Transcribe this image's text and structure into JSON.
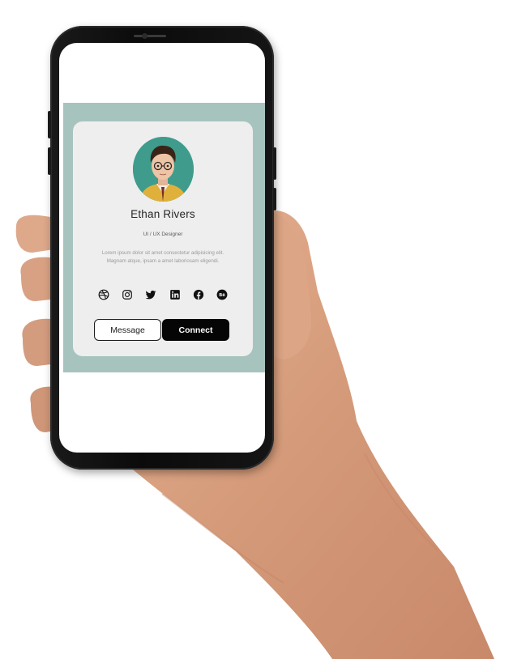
{
  "profile": {
    "name": "Ethan Rivers",
    "role": "UI / UX Designer",
    "bio": "Lorem ipsum dolor sit amet consectetur adipisicing elit. Magnam atque, ipsam a amet laboriosam eligendi."
  },
  "socials": [
    {
      "icon": "dribbble-icon"
    },
    {
      "icon": "instagram-icon"
    },
    {
      "icon": "twitter-icon"
    },
    {
      "icon": "linkedin-icon"
    },
    {
      "icon": "facebook-icon"
    },
    {
      "icon": "behance-icon",
      "label": "Bē"
    }
  ],
  "actions": {
    "message_label": "Message",
    "connect_label": "Connect"
  },
  "colors": {
    "app_background": "#a6c4bd",
    "card_background": "#eeeeee",
    "avatar_background": "#3f9c8c",
    "primary_button": "#050505"
  }
}
